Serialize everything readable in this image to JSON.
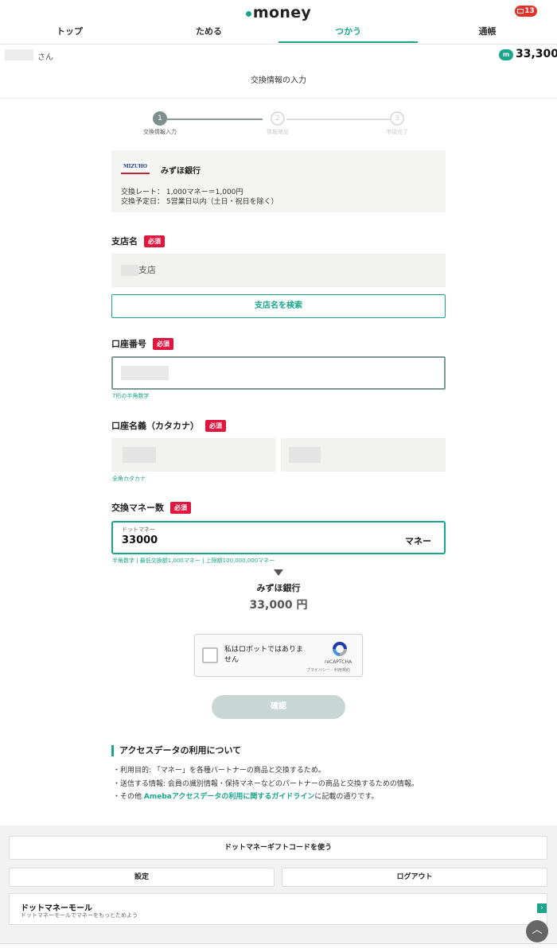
{
  "header": {
    "logo_text": "money",
    "mail_count": "13",
    "tabs": [
      {
        "label": "トップ"
      },
      {
        "label": "ためる"
      },
      {
        "label": "つかう"
      },
      {
        "label": "通帳"
      }
    ]
  },
  "user": {
    "suffix": "さん",
    "balance_icon": "m",
    "balance": "33,300"
  },
  "page_title": "交換情報の入力",
  "steps": [
    {
      "num": "1",
      "label": "交換情報入力"
    },
    {
      "num": "2",
      "label": "情報確認"
    },
    {
      "num": "3",
      "label": "申請完了"
    }
  ],
  "bank": {
    "logo_text": "MIZUHO",
    "name": "みずほ銀行",
    "rate": "交換レート： 1,000マネー＝1,000円",
    "schedule": "交換予定日： 5営業日以内（土日・祝日を除く）"
  },
  "required_label": "必須",
  "branch": {
    "label": "支店名",
    "value_suffix": "支店",
    "search_button": "支店名を検索"
  },
  "account_number": {
    "label": "口座番号",
    "hint": "7桁の半角数字"
  },
  "account_name": {
    "label": "口座名義（カタカナ）",
    "hint": "全角カタカナ"
  },
  "amount": {
    "label": "交換マネー数",
    "field_label": "ドットマネー",
    "value": "33000",
    "unit": "マネー",
    "hint": "半角数字 | 最低交換額1,000マネー | 上限額100,000,000マネー",
    "to_bank": "みずほ銀行",
    "to_amount": "33,000 円"
  },
  "captcha": {
    "text": "私はロボットではありません",
    "brand": "reCAPTCHA",
    "links": "プライバシー - 利用規約"
  },
  "confirm_button": "確認",
  "access_data": {
    "title": "アクセスデータの利用について",
    "line1": "・利用目的: 「マネー」を各種パートナーの商品と交換するため。",
    "line2": "・送信する情報: 会員の識別情報・保持マネーなどのパートナーの商品と交換するための情報。",
    "line3_prefix": "・その他 ",
    "line3_link": "Amebaアクセスデータの利用に関するガイドライン",
    "line3_suffix": "に記載の通りです。"
  },
  "footer": {
    "gift_code": "ドットマネーギフトコードを使う",
    "settings": "設定",
    "logout": "ログアウト",
    "mall_title": "ドットマネーモール",
    "mall_sub": "ドットマネーモールでマネーをもっとためよう",
    "mall_arrow": "›",
    "totop": "︿"
  },
  "colors": {
    "accent": "#1aa58c",
    "required": "#e0163f",
    "disabled_button": "#c8d7d4"
  }
}
